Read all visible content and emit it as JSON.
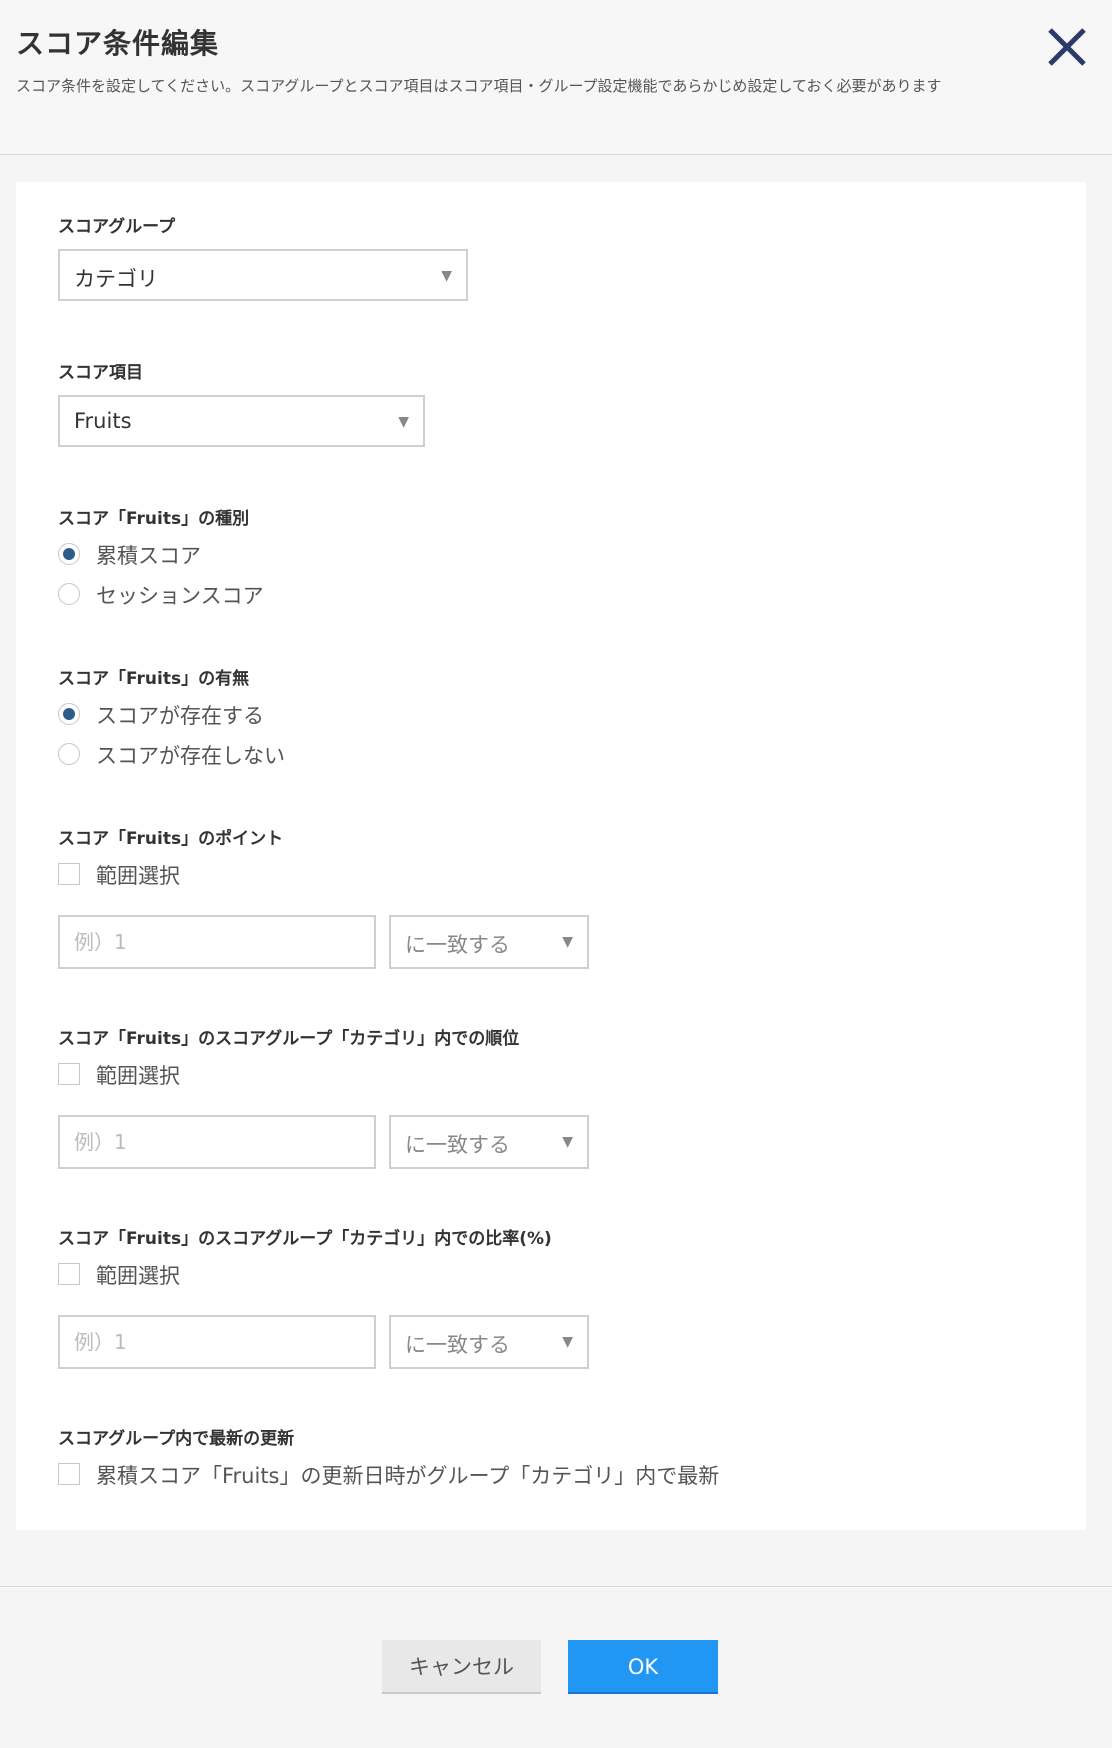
{
  "dialog": {
    "title": "スコア条件編集",
    "description": "スコア条件を設定してください。スコアグループとスコア項目はスコア項目・グループ設定機能であらかじめ設定しておく必要があります"
  },
  "score_group": {
    "label": "スコアグループ",
    "selected": "カテゴリ"
  },
  "score_item": {
    "label": "スコア項目",
    "selected": "Fruits"
  },
  "score_type": {
    "label": "スコア「Fruits」の種別",
    "options": [
      "累積スコア",
      "セッションスコア"
    ],
    "selected_index": 0
  },
  "score_existence": {
    "label": "スコア「Fruits」の有無",
    "options": [
      "スコアが存在する",
      "スコアが存在しない"
    ],
    "selected_index": 0
  },
  "point": {
    "label": "スコア「Fruits」のポイント",
    "range_label": "範囲選択",
    "placeholder": "例）1",
    "comparator": "に一致する"
  },
  "rank": {
    "label": "スコア「Fruits」のスコアグループ「カテゴリ」内での順位",
    "range_label": "範囲選択",
    "placeholder": "例）1",
    "comparator": "に一致する"
  },
  "ratio": {
    "label": "スコア「Fruits」のスコアグループ「カテゴリ」内での比率(%)",
    "range_label": "範囲選択",
    "placeholder": "例）1",
    "comparator": "に一致する"
  },
  "latest": {
    "label": "スコアグループ内で最新の更新",
    "option": "累積スコア「Fruits」の更新日時がグループ「カテゴリ」内で最新"
  },
  "buttons": {
    "cancel": "キャンセル",
    "ok": "OK"
  },
  "colors": {
    "primary": "#2196f3",
    "radio_selected": "#2d5b8a",
    "close_icon": "#2b3a67"
  }
}
